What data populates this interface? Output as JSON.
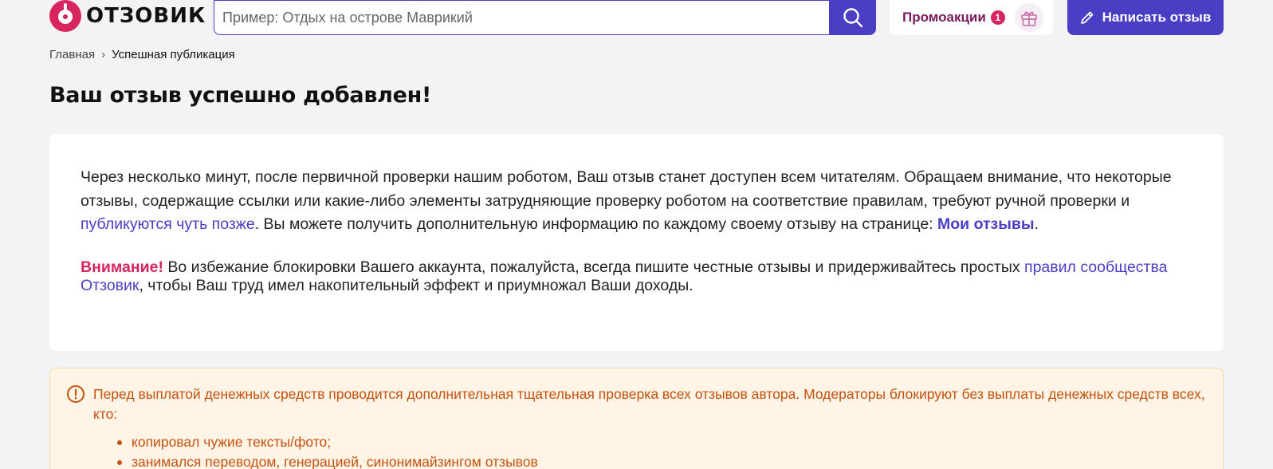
{
  "header": {
    "logo_text": "ОТЗОВИК",
    "search_placeholder": "Пример: Отдых на острове Маврикий",
    "promo_label": "Промоакции",
    "promo_count": "1",
    "write_label": "Написать отзыв"
  },
  "breadcrumb": {
    "home": "Главная",
    "separator": "›",
    "current": "Успешная публикация"
  },
  "page_title": "Ваш отзыв успешно добавлен!",
  "card": {
    "para1_start": "Через несколько минут, после первичной проверки нашим роботом, Ваш отзыв станет доступен всем читателям. Обращаем внимание, что некоторые отзывы, содержащие ссылки или какие-либо элементы затрудняющие проверку роботом на соответствие правилам, требуют ручной проверки и ",
    "para1_link": "публикуются чуть позже",
    "para1_middle": ". Вы можете получить дополнительную информацию по каждому своему отзыву на странице: ",
    "my_reviews_link": "Мои отзывы",
    "para1_end": ".",
    "warning_label": "Внимание!",
    "warning_text": " Во избежание блокировки Вашего аккаунта, пожалуйста, всегда пишите честные отзывы и придерживайтесь простых ",
    "rules_link": "правил сообщества Отзовик",
    "warning_end": ", чтобы Ваш труд имел накопительный эффект и приумножал Ваши доходы."
  },
  "alert": {
    "text": "Перед выплатой денежных средств проводится дополнительная тщательная проверка всех отзывов автора. Модераторы блокируют без выплаты денежных средств всех, кто:",
    "items": [
      "копировал чужие тексты/фото;",
      "занимался переводом, генерацией, синонимайзингом отзывов"
    ]
  },
  "colors": {
    "accent": "#4a3fc4",
    "brand": "#d6265d",
    "alert_text": "#c5510e",
    "alert_bg": "#fff4e6"
  }
}
